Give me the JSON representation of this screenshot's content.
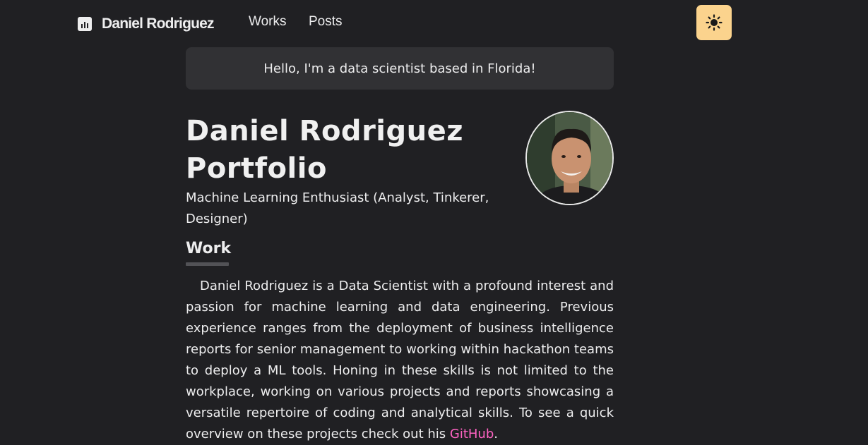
{
  "nav": {
    "brand": "Daniel Rodriguez",
    "links": [
      "Works",
      "Posts"
    ],
    "theme_toggle_icon": "sun-icon",
    "theme_toggle_color": "#fbd38d"
  },
  "banner": {
    "text": "Hello, I'm a data scientist based in Florida!"
  },
  "hero": {
    "title": "Daniel Rodriguez Portfolio",
    "subtitle": "Machine Learning Enthusiast (Analyst, Tinkerer, Designer)",
    "avatar": "profile-photo"
  },
  "work": {
    "heading": "Work",
    "bio_text": "Daniel Rodriguez is a Data Scientist with a profound interest and passion for machine learning and data engineering. Previous experience ranges from the deployment of business intelligence reports for senior management to working within hackathon teams to deploy a ML tools. Honing in these skills is not limited to the workplace, working on various projects and reports showcasing a versatile repertoire of coding and analytical skills. To see a quick overview on these projects check out his ",
    "link_text": "GitHub",
    "bio_end": ".",
    "link_color": "#ff63c3"
  }
}
